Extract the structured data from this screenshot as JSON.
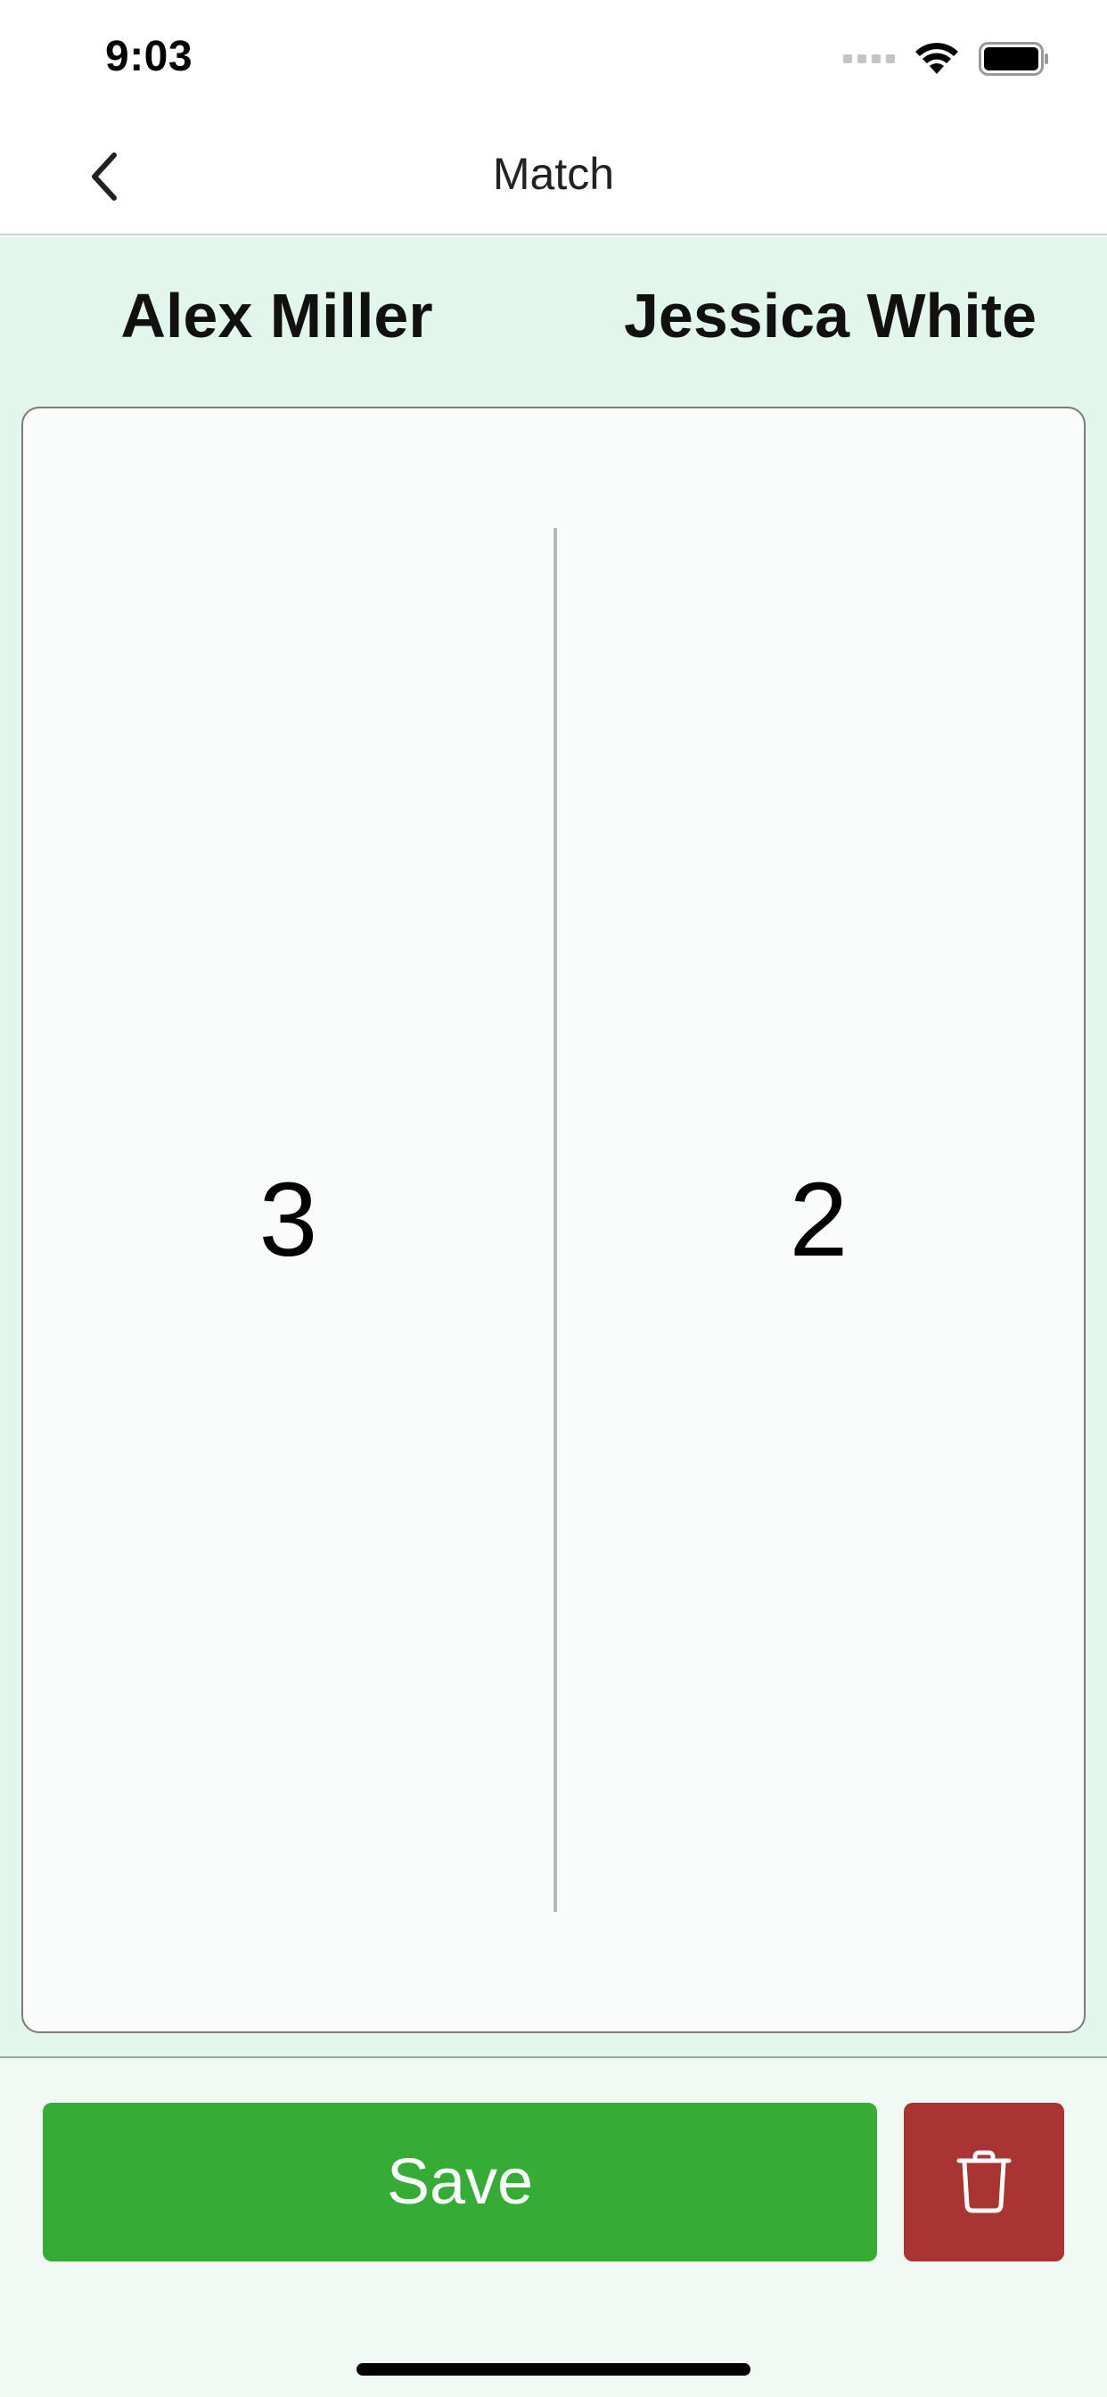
{
  "status_bar": {
    "time": "9:03",
    "icons": [
      "signal-icon",
      "wifi-icon",
      "battery-icon"
    ]
  },
  "nav": {
    "title": "Match",
    "back_icon": "chevron-left-icon"
  },
  "match": {
    "player_left": "Alex Miller",
    "player_right": "Jessica White",
    "score_left": "3",
    "score_right": "2"
  },
  "actions": {
    "save_label": "Save",
    "delete_icon": "trash-icon"
  },
  "colors": {
    "background": "#e2f6ec",
    "save": "#35ac36",
    "delete": "#a93434",
    "card": "#f9fcfb"
  }
}
